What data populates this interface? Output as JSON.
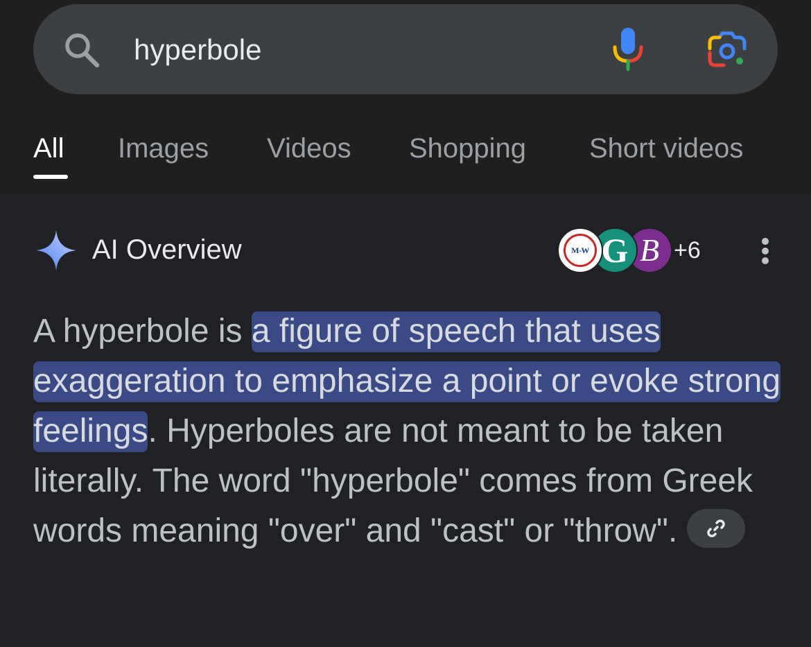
{
  "search": {
    "query": "hyperbole",
    "icons": [
      "search-icon",
      "mic-icon",
      "google-lens-icon"
    ]
  },
  "tabs": [
    {
      "label": "All",
      "active": true
    },
    {
      "label": "Images",
      "active": false
    },
    {
      "label": "Videos",
      "active": false
    },
    {
      "label": "Shopping",
      "active": false
    },
    {
      "label": "Short videos",
      "active": false
    }
  ],
  "ai_overview": {
    "title": "AI Overview",
    "icon": "sparkle-icon",
    "sources": {
      "avatars": [
        "M-W",
        "G",
        "B"
      ],
      "extra_count": "+6"
    },
    "text_before": "A hyperbole is ",
    "text_highlight": "a figure of speech that uses exaggeration to emphasize a point or evoke strong feelings",
    "text_after": ". Hyperboles are not meant to be taken literally. The word \"hyperbole\" comes from Greek words meaning \"over\" and \"cast\" or \"throw\"."
  },
  "colors": {
    "background": "#202124",
    "search_bar": "#3c4043",
    "highlight": "#394a85",
    "text": "#bdc1c6"
  }
}
